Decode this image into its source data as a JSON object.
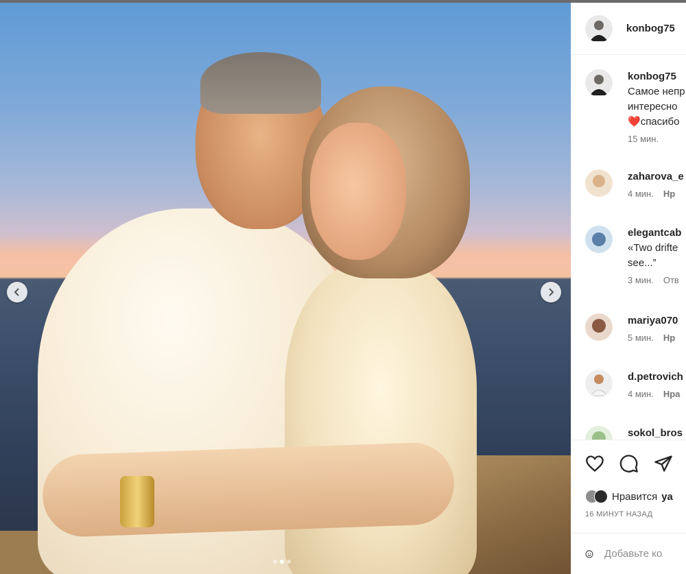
{
  "post": {
    "carousel": {
      "total": 3,
      "active_index": 1
    }
  },
  "panel": {
    "author": {
      "username": "konbog75"
    },
    "caption": {
      "username": "konbog75",
      "lines": [
        "Самое непр",
        "интересно",
        "спасибо"
      ],
      "heart": "❤️",
      "time": "15 мин."
    },
    "comments": [
      {
        "username": "zaharova_e",
        "time": "4 мин.",
        "action": "Нр",
        "avatar_color": "#d9b28a"
      },
      {
        "username": "elegantcab",
        "text_lines": [
          "«Two drifte",
          "see...”"
        ],
        "time": "3 мин.",
        "action": "Отв",
        "avatar_color": "#5a7fa8"
      },
      {
        "username": "mariya070",
        "time": "5 мин.",
        "action": "Нр",
        "avatar_color": "#8a5a45"
      },
      {
        "username": "d.petrovich",
        "time": "4 мин.",
        "action": "Нра",
        "avatar_color": "#c9b9a8"
      },
      {
        "username": "sokol_bros",
        "avatar_color": "#9bbf8a"
      }
    ],
    "likes": {
      "prefix": "Нравится",
      "user": "ya"
    },
    "time_ago": "16 МИНУТ НАЗАД",
    "add_comment": {
      "placeholder": "Добавьте ко"
    }
  },
  "icons": {
    "prev": "chevron-left-icon",
    "next": "chevron-right-icon",
    "like": "heart-icon",
    "comment": "comment-bubble-icon",
    "share": "paper-plane-icon",
    "emoji": "smiley-icon"
  }
}
